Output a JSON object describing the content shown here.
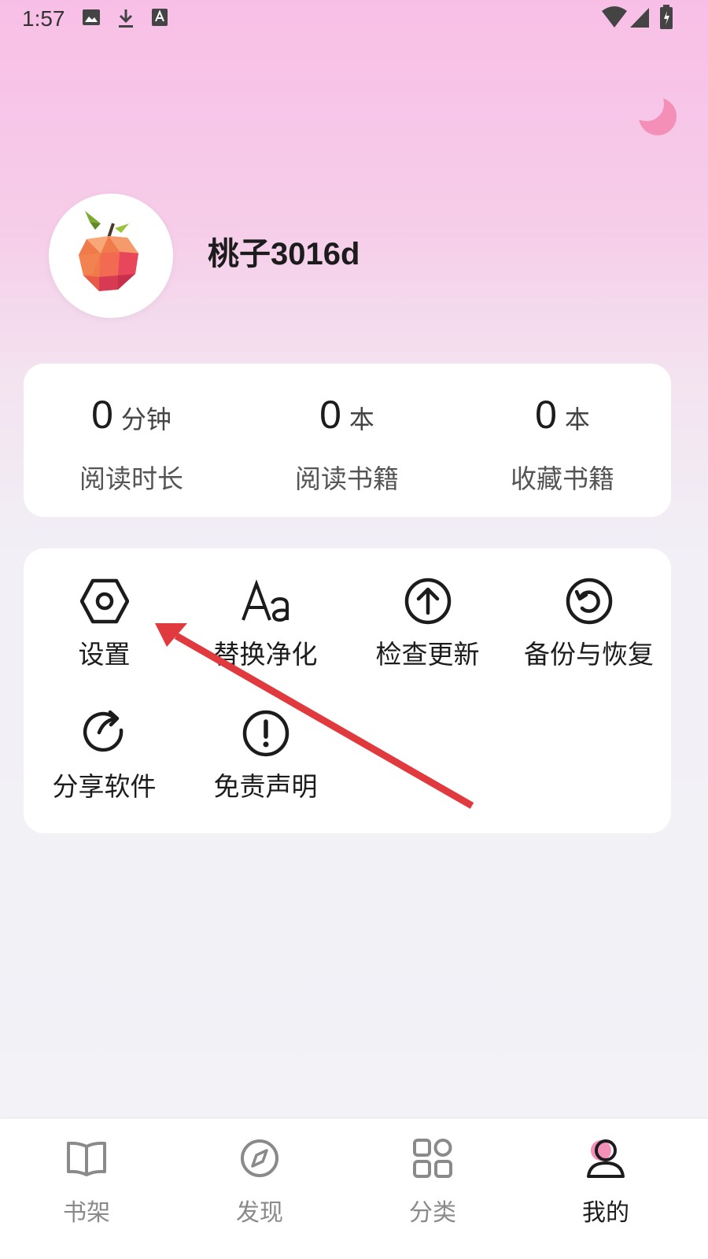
{
  "status_bar": {
    "time": "1:57",
    "left_icons": [
      "image-icon",
      "download-icon",
      "text-a-icon"
    ],
    "right_icons": [
      "wifi-icon",
      "signal-icon",
      "battery-icon"
    ]
  },
  "header": {
    "night_mode_icon": "moon-icon",
    "avatar_icon": "peach-icon",
    "username": "桃子3016d"
  },
  "stats": [
    {
      "value": "0",
      "unit": "分钟",
      "label": "阅读时长"
    },
    {
      "value": "0",
      "unit": "本",
      "label": "阅读书籍"
    },
    {
      "value": "0",
      "unit": "本",
      "label": "收藏书籍"
    }
  ],
  "menu": [
    {
      "icon": "settings-hexagon-icon",
      "label": "设置"
    },
    {
      "icon": "font-aa-icon",
      "label": "替换净化"
    },
    {
      "icon": "upload-circle-icon",
      "label": "检查更新"
    },
    {
      "icon": "restore-icon",
      "label": "备份与恢复"
    },
    {
      "icon": "share-icon",
      "label": "分享软件"
    },
    {
      "icon": "disclaimer-icon",
      "label": "免责声明"
    }
  ],
  "annotation": {
    "arrow_color": "#e03a3e"
  },
  "tabs": [
    {
      "icon": "bookshelf-icon",
      "label": "书架"
    },
    {
      "icon": "compass-icon",
      "label": "发现"
    },
    {
      "icon": "grid-icon",
      "label": "分类"
    },
    {
      "icon": "user-icon",
      "label": "我的",
      "active": true
    }
  ],
  "colors": {
    "accent_pink": "#f48fb8",
    "card_bg": "#ffffff",
    "active_tab": "#1c1c1c",
    "inactive_tab": "#8a8a8a"
  }
}
